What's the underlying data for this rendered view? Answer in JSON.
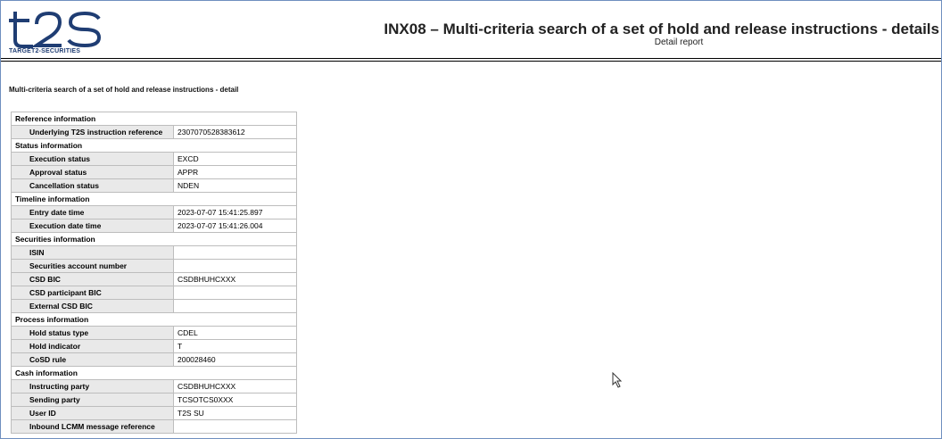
{
  "header": {
    "logo_caption": "TARGET2-SECURITIES",
    "title": "INX08 – Multi-criteria search of a set of hold and release instructions - details",
    "subtitle": "Detail report"
  },
  "section_heading": "Multi-criteria search of a set of hold and release instructions - detail",
  "rows": [
    {
      "group": "Reference information"
    },
    {
      "label": "Underlying T2S instruction reference",
      "value": "2307070528383612"
    },
    {
      "group": "Status information"
    },
    {
      "label": "Execution status",
      "value": "EXCD"
    },
    {
      "label": "Approval status",
      "value": "APPR"
    },
    {
      "label": "Cancellation status",
      "value": "NDEN"
    },
    {
      "group": "Timeline information"
    },
    {
      "label": "Entry date time",
      "value": "2023-07-07 15:41:25.897"
    },
    {
      "label": "Execution date time",
      "value": "2023-07-07 15:41:26.004"
    },
    {
      "group": "Securities information"
    },
    {
      "label": "ISIN",
      "value": ""
    },
    {
      "label": "Securities account number",
      "value": ""
    },
    {
      "label": "CSD BIC",
      "value": "CSDBHUHCXXX"
    },
    {
      "label": "CSD participant BIC",
      "value": ""
    },
    {
      "label": "External CSD BIC",
      "value": ""
    },
    {
      "group": "Process information"
    },
    {
      "label": "Hold status type",
      "value": "CDEL"
    },
    {
      "label": "Hold indicator",
      "value": "T"
    },
    {
      "label": "CoSD rule",
      "value": "200028460"
    },
    {
      "group": "Cash information"
    },
    {
      "label": "Instructing party",
      "value": "CSDBHUHCXXX"
    },
    {
      "label": "Sending party",
      "value": "TCSOTCS0XXX"
    },
    {
      "label": "User ID",
      "value": "T2S SU"
    },
    {
      "label": "Inbound LCMM message reference",
      "value": ""
    }
  ],
  "icons": {
    "logo": "t2s-logo-icon",
    "cursor": "mouse-pointer-icon"
  },
  "colors": {
    "logo_blue": "#1f3d73",
    "label_bg": "#e9e9e9",
    "border": "#bdbdbd"
  }
}
